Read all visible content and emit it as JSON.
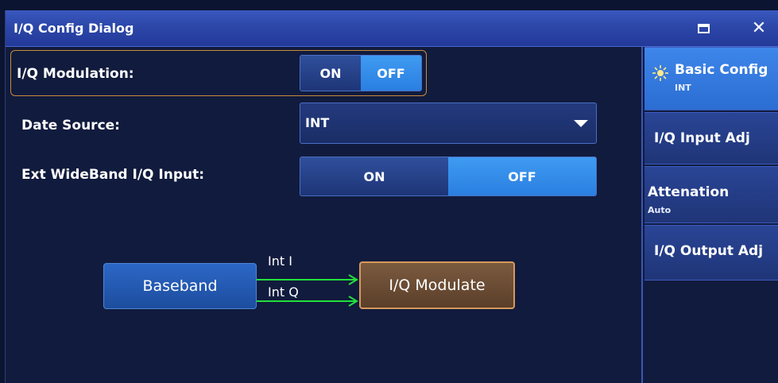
{
  "window": {
    "title": "I/Q Config Dialog"
  },
  "form": {
    "iq_modulation": {
      "label": "I/Q Modulation:",
      "on_label": "ON",
      "off_label": "OFF",
      "selected": "OFF"
    },
    "data_source": {
      "label": "Date Source:",
      "value": "INT"
    },
    "ext_wideband": {
      "label": "Ext WideBand I/Q Input:",
      "on_label": "ON",
      "off_label": "OFF",
      "selected": "OFF"
    }
  },
  "diagram": {
    "baseband": "Baseband",
    "modulate": "I/Q Modulate",
    "signal_i": "Int I",
    "signal_q": "Int Q"
  },
  "sidebar": {
    "items": [
      {
        "title": "Basic Config",
        "subtitle": "INT",
        "icon": "sun-icon"
      },
      {
        "title": "I/Q Input Adj",
        "subtitle": ""
      },
      {
        "title": "Attenation",
        "subtitle": "Auto"
      },
      {
        "title": "I/Q Output Adj",
        "subtitle": ""
      }
    ]
  },
  "colors": {
    "titlebar": "#2c47a8",
    "active_toggle": "#3f9bf2",
    "highlight_border": "#c98a3c",
    "arrow": "#22e03a",
    "modulate_border": "#d7995a"
  }
}
